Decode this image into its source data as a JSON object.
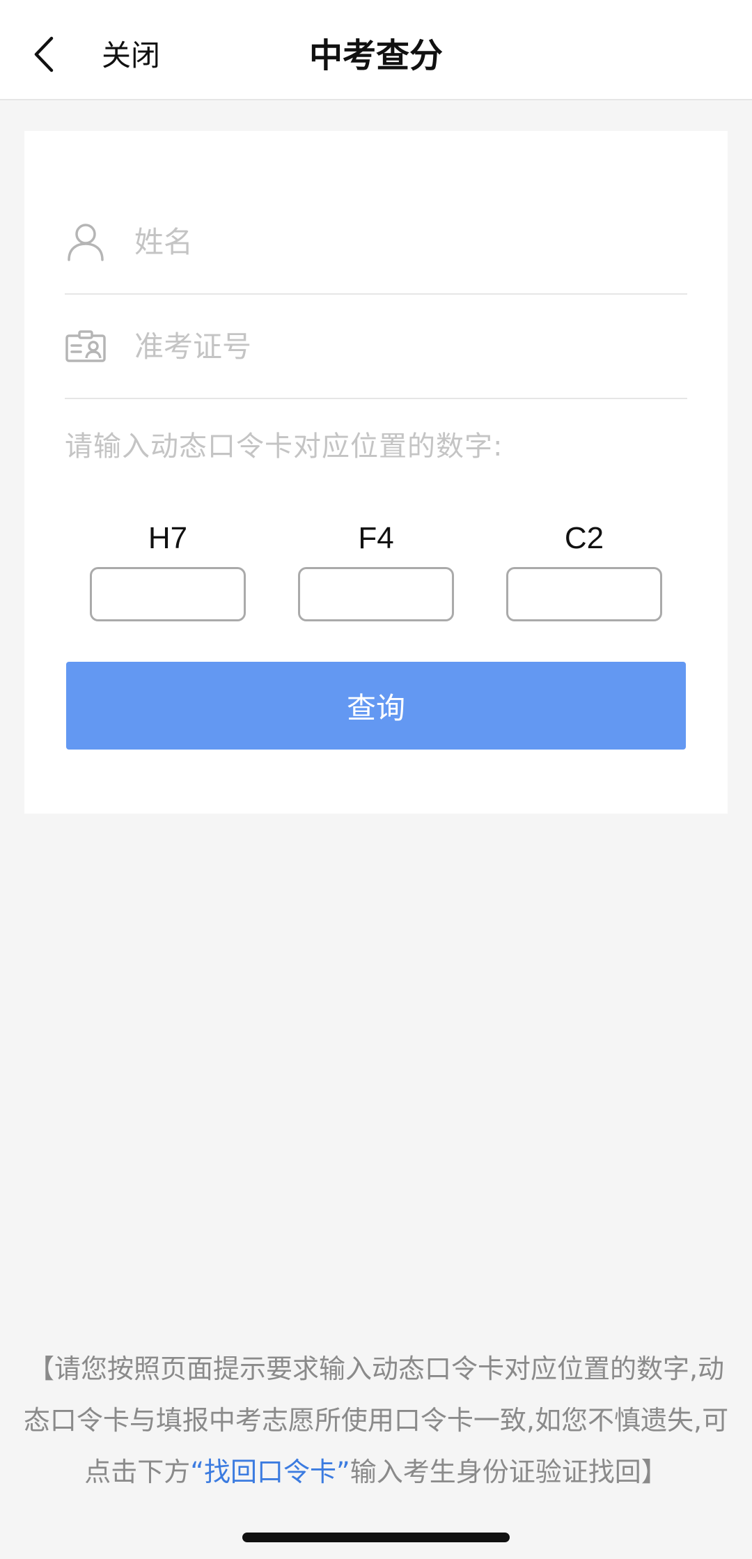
{
  "nav": {
    "close_label": "关闭",
    "title": "中考查分"
  },
  "form": {
    "name_placeholder": "姓名",
    "ticket_placeholder": "准考证号",
    "code_hint": "请输入动态口令卡对应位置的数字:",
    "codes": [
      {
        "label": "H7",
        "value": ""
      },
      {
        "label": "F4",
        "value": ""
      },
      {
        "label": "C2",
        "value": ""
      }
    ],
    "submit_label": "查询"
  },
  "notice": {
    "text_before": "【请您按照页面提示要求输入动态口令卡对应位置的数字,动态口令卡与填报中考志愿所使用口令卡一致,如您不慎遗失,可点击下方",
    "link_text": "“找回口令卡”",
    "text_after": "输入考生身份证验证找回】"
  },
  "colors": {
    "accent": "#6398f2",
    "link": "#3b7be0",
    "background": "#f5f5f5"
  }
}
